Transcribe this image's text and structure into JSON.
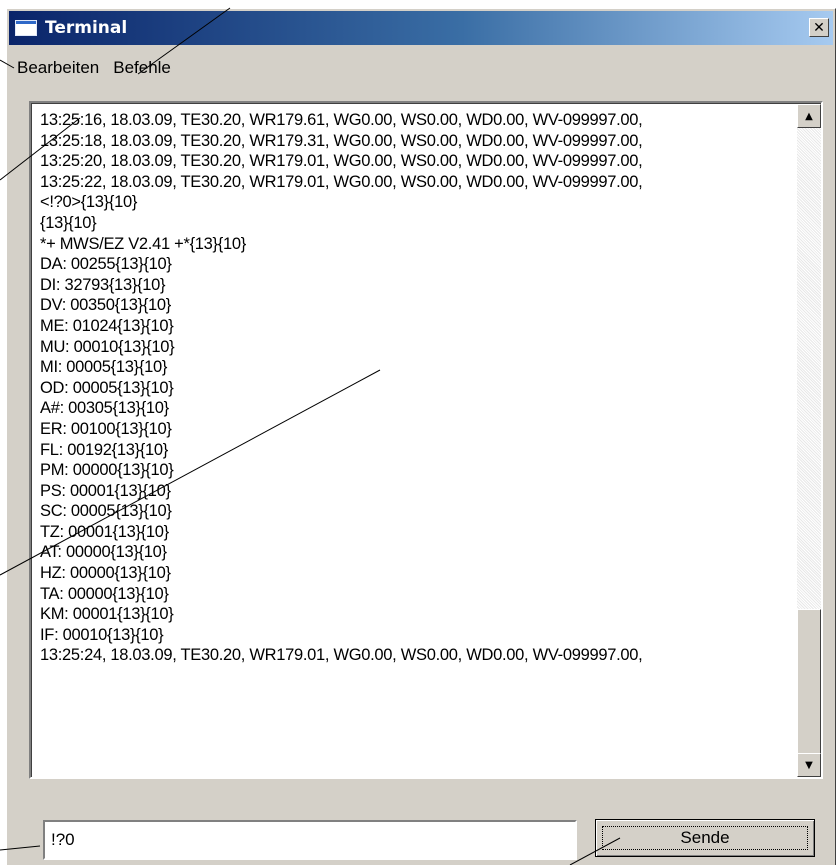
{
  "window": {
    "title": "Terminal",
    "close_glyph": "✕"
  },
  "menu": {
    "items": [
      "Bearbeiten",
      "Befehle"
    ]
  },
  "terminal": {
    "lines": [
      "13:25:16, 18.03.09, TE30.20, WR179.61, WG0.00, WS0.00, WD0.00, WV-099997.00,",
      "13:25:18, 18.03.09, TE30.20, WR179.31, WG0.00, WS0.00, WD0.00, WV-099997.00,",
      "13:25:20, 18.03.09, TE30.20, WR179.01, WG0.00, WS0.00, WD0.00, WV-099997.00,",
      "13:25:22, 18.03.09, TE30.20, WR179.01, WG0.00, WS0.00, WD0.00, WV-099997.00,",
      "<!?0>{13}{10}",
      "{13}{10}",
      "*+ MWS/EZ V2.41 +*{13}{10}",
      "DA: 00255{13}{10}",
      "DI: 32793{13}{10}",
      "DV: 00350{13}{10}",
      "ME: 01024{13}{10}",
      "MU: 00010{13}{10}",
      "MI: 00005{13}{10}",
      "OD: 00005{13}{10}",
      "A#: 00305{13}{10}",
      "ER: 00100{13}{10}",
      "FL: 00192{13}{10}",
      "PM: 00000{13}{10}",
      "PS: 00001{13}{10}",
      "SC: 00005{13}{10}",
      "TZ: 00001{13}{10}",
      "AT: 00000{13}{10}",
      "HZ: 00000{13}{10}",
      "TA: 00000{13}{10}",
      "KM: 00001{13}{10}",
      "IF: 00010{13}{10}",
      "13:25:24, 18.03.09, TE30.20, WR179.01, WG0.00, WS0.00, WD0.00, WV-099997.00,"
    ],
    "scroll_position": 0.9
  },
  "command": {
    "value": "!?0"
  },
  "send_button": {
    "label": "Sende"
  },
  "colors": {
    "titlebar_start": "#0a246a",
    "titlebar_end": "#a6caf0",
    "face": "#d4d0c8"
  }
}
